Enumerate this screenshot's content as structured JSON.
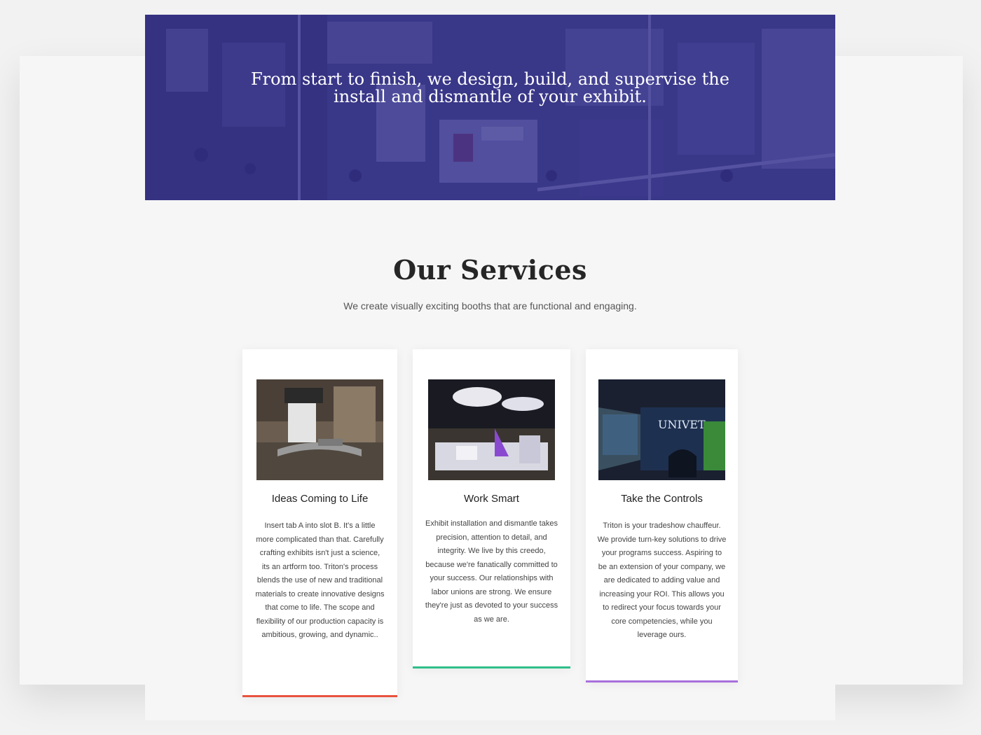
{
  "hero": {
    "text": "From start to finish, we design, build, and supervise the install and dismantle of your exhibit."
  },
  "services": {
    "title": "Our Services",
    "subtitle": "We create visually exciting booths that are functional and engaging.",
    "cards": [
      {
        "title": "Ideas Coming to Life",
        "text": "Insert tab A into slot B. It's a little more complicated than that. Carefully crafting exhibits isn't just a science, its an artform too. Triton's process blends the use of new and traditional materials to create innovative designs that come to life. The scope and flexibility of our production capacity is ambitious, growing, and dynamic..",
        "accent": "#e8533f"
      },
      {
        "title": "Work Smart",
        "text": "Exhibit installation and dismantle takes precision, attention to detail, and integrity. We live by this creedo, because we're fanatically committed to your success. Our relationships with labor unions are strong. We ensure they're just as devoted to your success as we are.",
        "accent": "#2fbf8a"
      },
      {
        "title": "Take the Controls",
        "text": "Triton is your tradeshow chauffeur. We provide turn-key solutions to drive your programs success. Aspiring to be an extension of your company, we are dedicated to adding value and increasing your ROI. This allows you to redirect your focus towards your core competencies, while you leverage ours.",
        "accent": "#a86fdc"
      }
    ]
  }
}
